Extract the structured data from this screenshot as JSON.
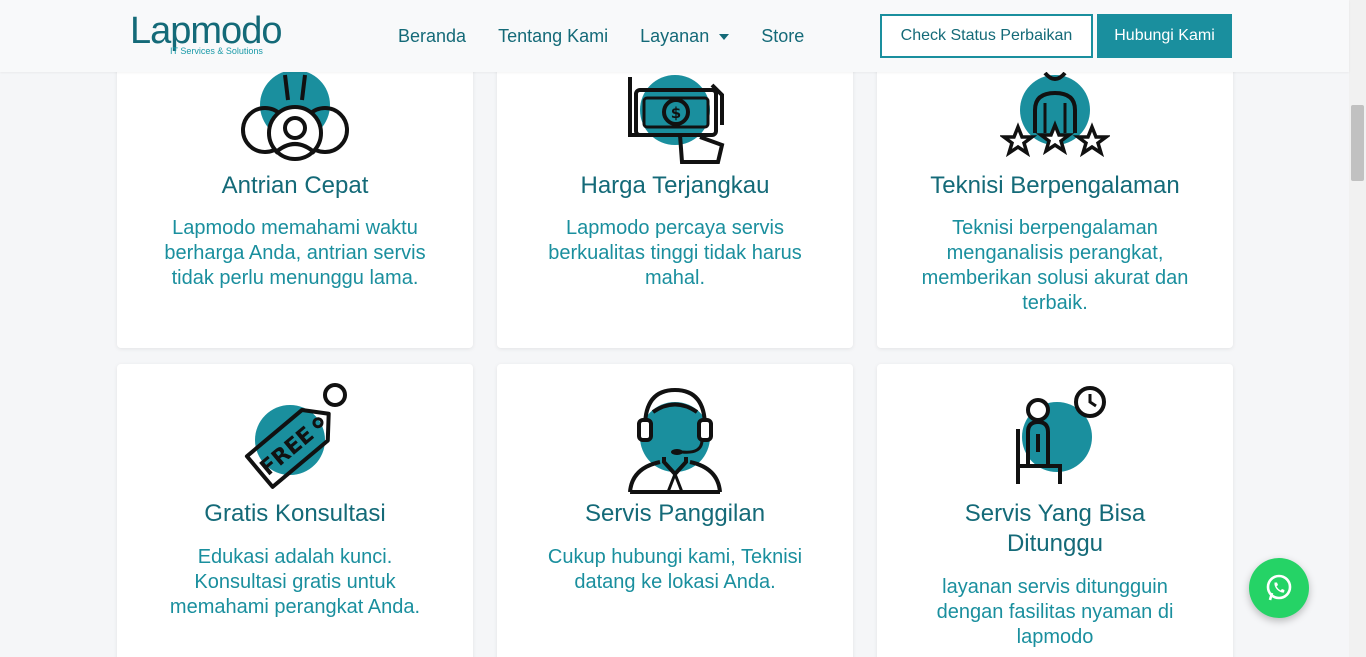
{
  "brand": {
    "name": "Lapmodo",
    "tagline": "IT Services & Solutions"
  },
  "nav": {
    "items": [
      {
        "label": "Beranda"
      },
      {
        "label": "Tentang Kami"
      },
      {
        "label": "Layanan"
      },
      {
        "label": "Store"
      }
    ],
    "check_status_label": "Check Status Perbaikan",
    "contact_label": "Hubungi Kami"
  },
  "features": [
    {
      "title": "Antrian Cepat",
      "desc": "Lapmodo memahami waktu berharga Anda, antrian servis tidak perlu menunggu lama.",
      "icon": "queue-icon"
    },
    {
      "title": "Harga Terjangkau",
      "desc": "Lapmodo percaya servis berkualitas tinggi tidak harus mahal.",
      "icon": "money-hand-icon"
    },
    {
      "title": "Teknisi Berpengalaman",
      "desc": "Teknisi berpengalaman menganalisis perangkat, memberikan solusi akurat dan terbaik.",
      "icon": "technician-stars-icon"
    },
    {
      "title": "Gratis Konsultasi",
      "desc": "Edukasi adalah kunci. Konsultasi gratis untuk memahami perangkat Anda.",
      "icon": "free-tag-icon"
    },
    {
      "title": "Servis Panggilan",
      "desc": "Cukup hubungi kami, Teknisi datang ke lokasi Anda.",
      "icon": "headset-agent-icon"
    },
    {
      "title": "Servis Yang Bisa Ditunggu",
      "desc": "layanan servis ditungguin dengan fasilitas nyaman di lapmodo",
      "icon": "waiting-clock-icon"
    }
  ],
  "colors": {
    "primary": "#146a78",
    "accent": "#1a8f9e",
    "whatsapp": "#25d366"
  },
  "whatsapp_icon": "whatsapp-icon"
}
